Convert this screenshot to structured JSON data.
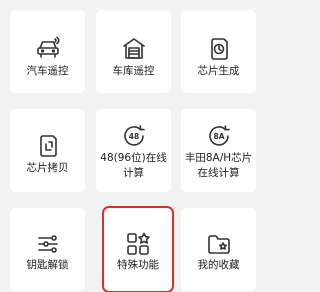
{
  "grid": {
    "tiles": [
      {
        "label": "汽车遥控",
        "icon": "car-remote-icon"
      },
      {
        "label": "车库遥控",
        "icon": "garage-remote-icon"
      },
      {
        "label": "芯片生成",
        "icon": "chip-generate-icon"
      },
      {
        "label": "芯片拷贝",
        "icon": "chip-copy-icon"
      },
      {
        "label": "48(96位)在线计算",
        "icon": "48-96-calc-icon"
      },
      {
        "label": "丰田8A/H芯片在线计算",
        "icon": "toyota-8a-calc-icon"
      },
      {
        "label": "钥匙解锁",
        "icon": "key-unlock-icon"
      },
      {
        "label": "特殊功能",
        "icon": "special-functions-icon",
        "highlighted": true
      },
      {
        "label": "我的收藏",
        "icon": "favorites-folder-icon"
      }
    ],
    "icon_badges": {
      "48": "48",
      "8a": "8A"
    }
  },
  "colors": {
    "background": "#f2f2f2",
    "tile": "#ffffff",
    "text": "#222222",
    "icon": "#333333",
    "highlight": "#d9322e"
  }
}
